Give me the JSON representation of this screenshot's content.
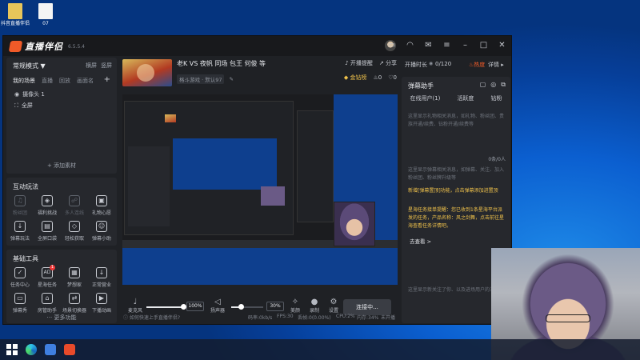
{
  "desktop": {
    "icons": [
      {
        "label": "抖音直播伴侣",
        "color": "#e7c55a"
      },
      {
        "label": "07",
        "color": "#f4f4f4"
      }
    ]
  },
  "app": {
    "name": "直播伴侣",
    "version": "6.5.5.4",
    "titlebar_icons": [
      "chat-icon",
      "headset-icon",
      "message-icon",
      "menu-icon",
      "minimize-icon",
      "maximize-icon",
      "close-icon"
    ]
  },
  "left": {
    "mode_label": "常规模式 ▼",
    "mode_links": [
      "横屏",
      "竖屏"
    ],
    "scene_title": "我的场景",
    "scene_tabs": [
      "直播",
      "回放",
      "画面名"
    ],
    "scene_add": "+",
    "sources": [
      "摄像头 1",
      "全屏"
    ],
    "add_source": "+ 添加素材",
    "interactive_title": "互动玩法",
    "interactive_items": [
      {
        "label": "粉丝团",
        "icon": "pk-icon",
        "dim": true
      },
      {
        "label": "福利挑战",
        "icon": "shield-icon",
        "dim": false
      },
      {
        "label": "多人连线",
        "icon": "multi-link-icon",
        "dim": true
      },
      {
        "label": "礼物心愿",
        "icon": "gift-icon",
        "dim": false
      },
      {
        "label": "弹幕玩法",
        "icon": "download-icon",
        "dim": false
      },
      {
        "label": "全屏口袋",
        "icon": "pocket-icon",
        "dim": false
      },
      {
        "label": "轻松获取",
        "icon": "diamond-icon",
        "dim": false
      },
      {
        "label": "弹幕小助",
        "icon": "bot-icon",
        "dim": false
      }
    ],
    "tools_title": "基础工具",
    "tools_items": [
      {
        "label": "任务中心",
        "icon": "task-icon",
        "badge": ""
      },
      {
        "label": "星海任务",
        "icon": "ad-icon",
        "badge": "1"
      },
      {
        "label": "梦想家",
        "icon": "dream-icon",
        "badge": ""
      },
      {
        "label": "正常营业",
        "icon": "download-icon",
        "badge": ""
      },
      {
        "label": "弹幕秀",
        "icon": "danmu-icon",
        "badge": ""
      },
      {
        "label": "房管助手",
        "icon": "manager-icon",
        "badge": ""
      },
      {
        "label": "场景切换器",
        "icon": "switch-icon",
        "badge": ""
      },
      {
        "label": "下播动画",
        "icon": "video-icon",
        "badge": ""
      }
    ],
    "more": "··· 更多功能"
  },
  "center": {
    "room_title": "老K VS 夜帆 同场 包王 何俊 等",
    "category": "格斗游戏 · 默认97",
    "actions": [
      "开播提醒",
      "分享"
    ],
    "gold_label": "金钻榜",
    "like_count": "0",
    "heart_count": "0",
    "mic_label": "麦克风",
    "mic_pct": "100%",
    "mic_level": 1.0,
    "speaker_label": "扬声器",
    "speaker_pct": "30%",
    "speaker_level": 0.3,
    "tools": [
      "美颜",
      "录制",
      "设置"
    ],
    "live_button": "连接中...",
    "status_hint": "如何快速上手直播伴侣?",
    "status_stats": [
      "码率:0kb/s",
      "FPS:30",
      "丢帧:0(0.00%)",
      "CPU:2%",
      "内存:34%",
      "未开播"
    ]
  },
  "right": {
    "duration_label": "开播时长",
    "viewers": "0/120",
    "hot_label": "热度",
    "detail_label": "详情 ▸",
    "panel_title": "弹幕助手",
    "chat_tabs": [
      "在线用户(1)",
      "活跃度",
      "钻粉"
    ],
    "tip1": "这里显示礼物相关消息，如礼物、粉丝团、贵族开通/续费、钻粉开通/续费等",
    "count_label": "0条/0人",
    "tip2": "这里显示弹幕相关消息，如弹幕、关注、加入粉丝团、粉丝牌升级等",
    "notice1": "新增[弹幕置顶]功能，点击弹幕添加进置顶",
    "notice2": "星海任务接单提醒：您已收到1条星海平台派发的任务，产品名称：风之剑舞，点击前往星海查看任务详情吧。",
    "notice_link": "去查看 >",
    "tip3": "这里显示新关注了你、以及进场用户的消息"
  },
  "taskbar": {
    "icons": [
      "windows-start-icon",
      "edge-icon",
      "settings-app-icon",
      "douyin-companion-icon"
    ]
  }
}
